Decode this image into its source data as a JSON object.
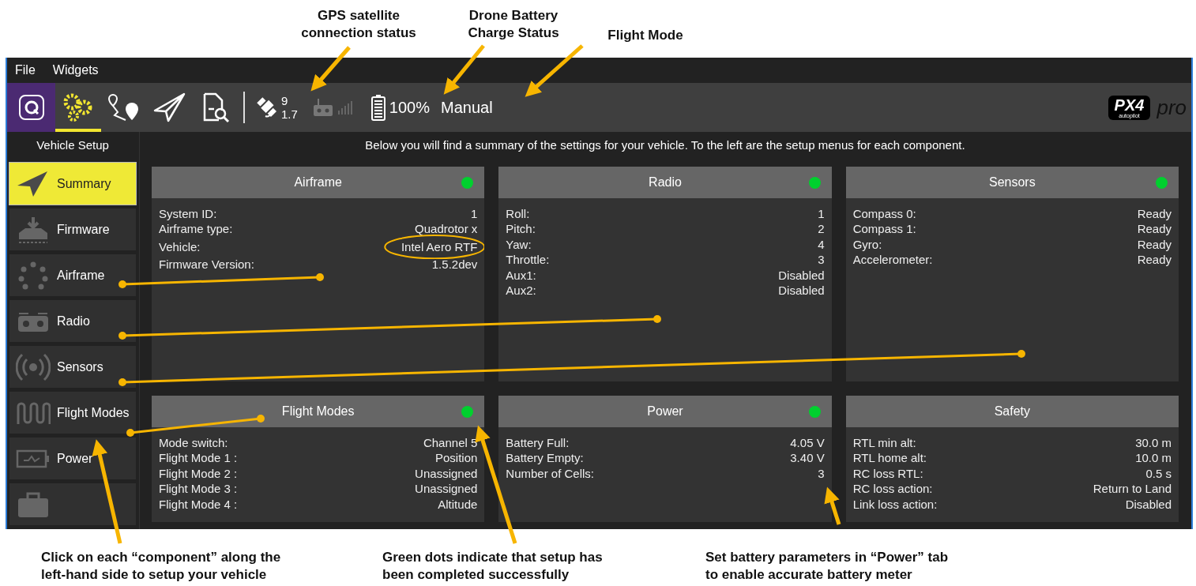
{
  "callouts_top": [
    {
      "kind": "gps",
      "text": "GPS satellite\nconnection status"
    },
    {
      "kind": "battery",
      "text": "Drone Battery\nCharge Status"
    },
    {
      "kind": "mode",
      "text": "Flight Mode"
    }
  ],
  "menu": [
    "File",
    "Widgets"
  ],
  "toolbar": {
    "tools": [
      {
        "kind": "app",
        "selected": false
      },
      {
        "kind": "setup",
        "selected": true
      },
      {
        "kind": "plan",
        "selected": false
      },
      {
        "kind": "fly",
        "selected": false
      },
      {
        "kind": "analyze",
        "selected": false
      }
    ],
    "gps": {
      "count": "9",
      "hdop": "1.7"
    },
    "battery": "100%",
    "flight_mode": "Manual",
    "logo": {
      "mark": "PX4",
      "sub": "autopilot",
      "suffix": "pro"
    }
  },
  "sidebar": {
    "heading": "Vehicle Setup",
    "items": [
      {
        "label": "Summary",
        "selected": true
      },
      {
        "label": "Firmware",
        "selected": false
      },
      {
        "label": "Airframe",
        "selected": false
      },
      {
        "label": "Radio",
        "selected": false
      },
      {
        "label": "Sensors",
        "selected": false
      },
      {
        "label": "Flight Modes",
        "selected": false
      },
      {
        "label": "Power",
        "selected": false
      },
      {
        "selected": false
      }
    ]
  },
  "summary": "Below you will find a summary of the settings for your vehicle. To the left are the setup menus for each component.",
  "cards": [
    {
      "title": "Airframe",
      "complete": true,
      "rows": [
        [
          "System ID:",
          "1"
        ],
        [
          "Airframe type:",
          "Quadrotor x"
        ],
        [
          "Vehicle:",
          "Intel Aero RTF"
        ],
        [
          "Firmware Version:",
          "1.5.2dev"
        ]
      ],
      "circled": [
        false,
        false,
        true,
        false
      ]
    },
    {
      "title": "Radio",
      "complete": true,
      "rows": [
        [
          "Roll:",
          "1"
        ],
        [
          "Pitch:",
          "2"
        ],
        [
          "Yaw:",
          "4"
        ],
        [
          "Throttle:",
          "3"
        ],
        [
          "Aux1:",
          "Disabled"
        ],
        [
          "Aux2:",
          "Disabled"
        ]
      ]
    },
    {
      "title": "Sensors",
      "complete": true,
      "rows": [
        [
          "Compass 0:",
          "Ready"
        ],
        [
          "Compass 1:",
          "Ready"
        ],
        [
          "Gyro:",
          "Ready"
        ],
        [
          "Accelerometer:",
          "Ready"
        ]
      ]
    },
    {
      "title": "Flight Modes",
      "complete": true,
      "rows": [
        [
          "Mode switch:",
          "Channel 5"
        ],
        [
          "Flight Mode 1 :",
          "Position"
        ],
        [
          "Flight Mode 2 :",
          "Unassigned"
        ],
        [
          "Flight Mode 3 :",
          "Unassigned"
        ],
        [
          "Flight Mode 4 :",
          "Altitude"
        ]
      ]
    },
    {
      "title": "Power",
      "complete": true,
      "rows": [
        [
          "Battery Full:",
          "4.05 V"
        ],
        [
          "Battery Empty:",
          "3.40 V"
        ],
        [
          "Number of Cells:",
          "3"
        ]
      ]
    },
    {
      "title": "Safety",
      "complete": false,
      "rows": [
        [
          "RTL min alt:",
          "30.0 m"
        ],
        [
          "RTL home alt:",
          "10.0 m"
        ],
        [
          "RC loss RTL:",
          "0.5 s"
        ],
        [
          "RC loss action:",
          "Return to Land"
        ],
        [
          "Link loss action:",
          "Disabled"
        ]
      ]
    }
  ],
  "callouts_bottom": [
    "Click on each “component” along the\nleft-hand side to setup your vehicle",
    "Green dots indicate that setup has\nbeen completed successfully",
    "Set battery parameters in “Power” tab\nto enable accurate battery meter"
  ]
}
